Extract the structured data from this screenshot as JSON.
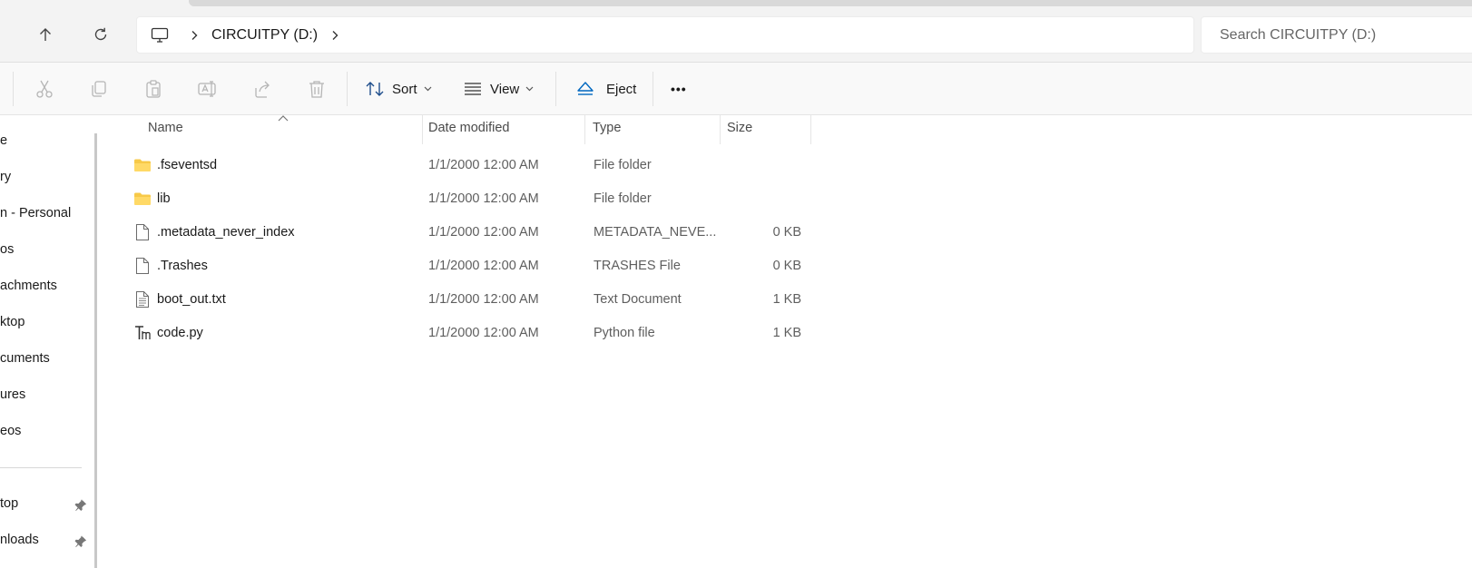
{
  "address_bar": {
    "breadcrumb": "CIRCUITPY (D:)",
    "search_placeholder": "Search CIRCUITPY (D:)"
  },
  "command_bar": {
    "sort_label": "Sort",
    "view_label": "View",
    "eject_label": "Eject",
    "more_label": "•••"
  },
  "sidebar": {
    "items": [
      {
        "label": "e"
      },
      {
        "label": "ry"
      },
      {
        "label": "n - Personal"
      },
      {
        "label": "os"
      },
      {
        "label": "achments"
      },
      {
        "label": "ktop"
      },
      {
        "label": "cuments"
      },
      {
        "label": "ures"
      },
      {
        "label": "eos"
      }
    ],
    "pinned": [
      {
        "label": "top"
      },
      {
        "label": "nloads"
      }
    ]
  },
  "file_list": {
    "columns": [
      "Name",
      "Date modified",
      "Type",
      "Size"
    ],
    "rows": [
      {
        "icon": "folder-icon",
        "name": ".fseventsd",
        "date": "1/1/2000 12:00 AM",
        "type": "File folder",
        "size": ""
      },
      {
        "icon": "folder-icon",
        "name": "lib",
        "date": "1/1/2000 12:00 AM",
        "type": "File folder",
        "size": ""
      },
      {
        "icon": "file-icon",
        "name": ".metadata_never_index",
        "date": "1/1/2000 12:00 AM",
        "type": "METADATA_NEVE...",
        "size": "0 KB"
      },
      {
        "icon": "file-icon",
        "name": ".Trashes",
        "date": "1/1/2000 12:00 AM",
        "type": "TRASHES File",
        "size": "0 KB"
      },
      {
        "icon": "text-file-icon",
        "name": "boot_out.txt",
        "date": "1/1/2000 12:00 AM",
        "type": "Text Document",
        "size": "1 KB"
      },
      {
        "icon": "python-file-icon",
        "name": "code.py",
        "date": "1/1/2000 12:00 AM",
        "type": "Python file",
        "size": "1 KB"
      }
    ]
  },
  "colors": {
    "folder": "#f7c948",
    "accent": "#0067c0",
    "disabled_icon": "#b5b5b5"
  }
}
